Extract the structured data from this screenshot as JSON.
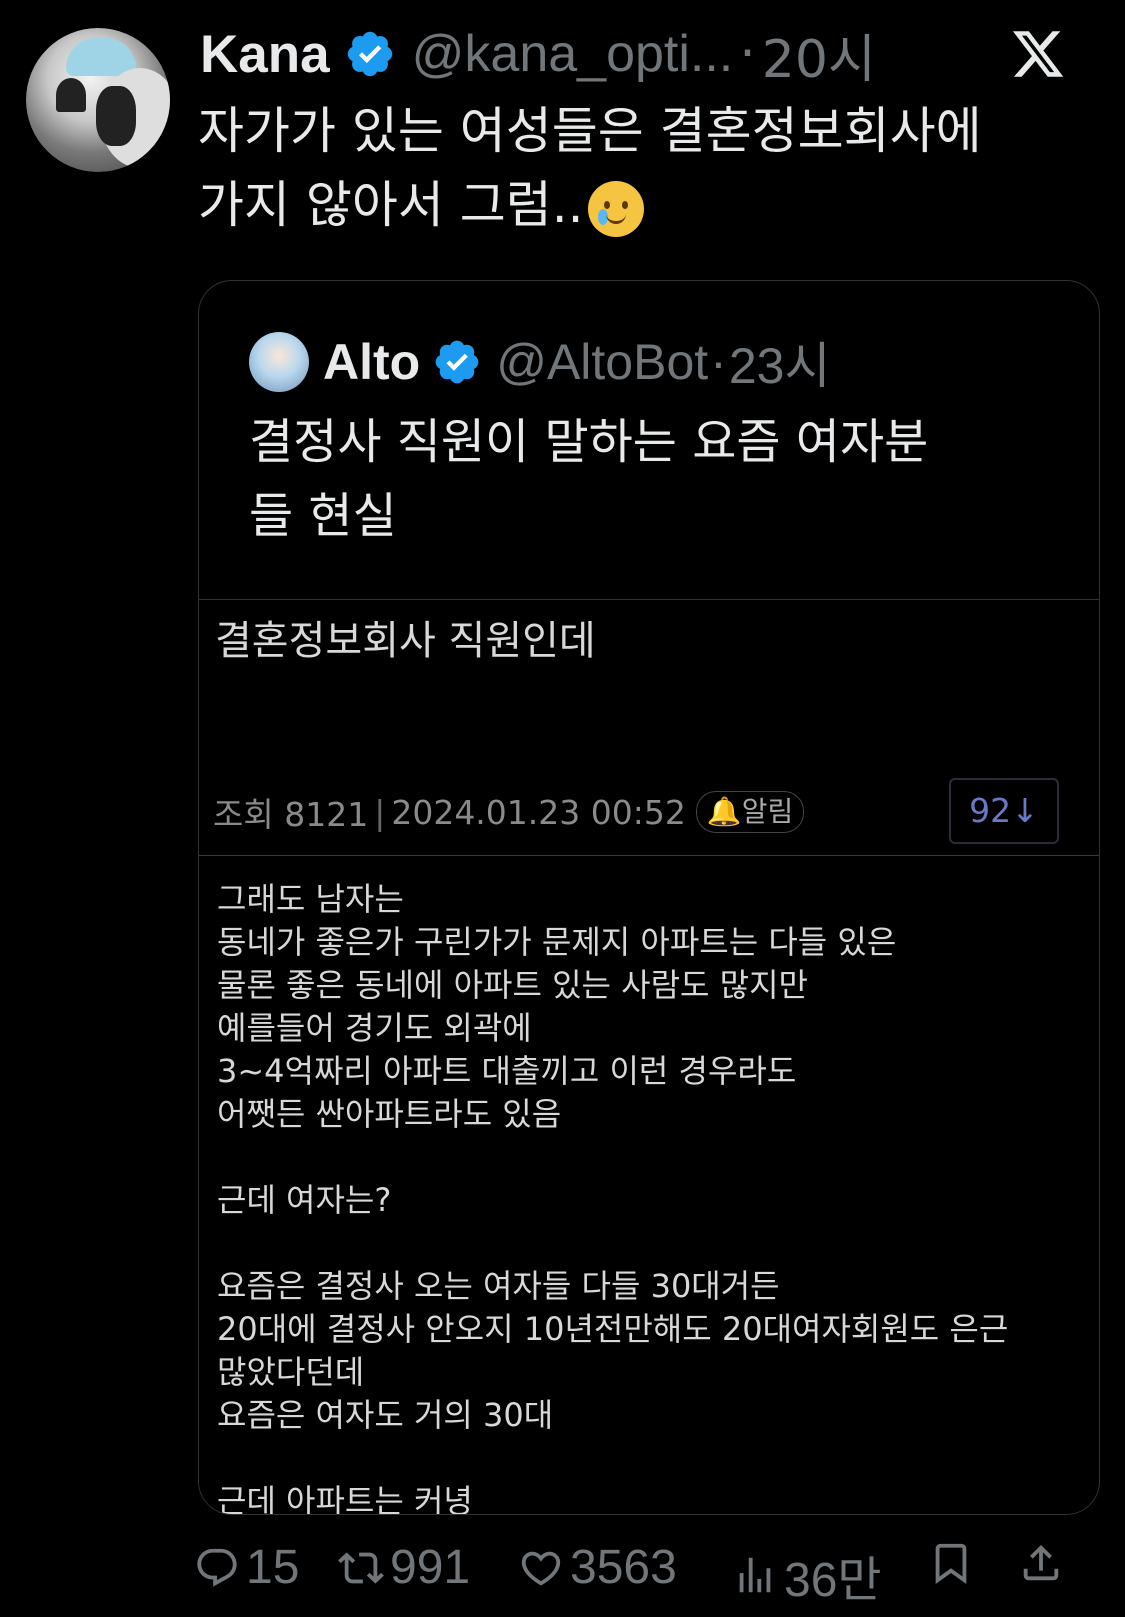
{
  "tweet": {
    "author_name": "Kana",
    "handle": "@kana_opti...",
    "separator": "·",
    "time": "20시",
    "text_line1": "자가가 있는 여성들은 결혼정보회사에",
    "text_line2": "가지 않아서 그럼..",
    "emoji": "face-holding-back-tears"
  },
  "quoted": {
    "author_name": "Alto",
    "handle": "@AltoBot",
    "separator": "·",
    "time": "23시",
    "text_line1": "결정사 직원이 말하는 요즘 여자분",
    "text_line2": "들 현실"
  },
  "media": {
    "title": "결혼정보회사 직원인데",
    "views": "조회 8121",
    "date": "2024.01.23 00:52",
    "alarm": "알림",
    "count": "92",
    "body": [
      "그래도 남자는",
      "동네가 좋은가 구린가가 문제지 아파트는 다들 있은",
      "물론 좋은 동네에 아파트 있는 사람도 많지만",
      "예를들어 경기도 외곽에",
      "3~4억짜리 아파트 대출끼고 이런 경우라도",
      "어쨋든 싼아파트라도 있음",
      "",
      "근데 여자는?",
      "",
      "요즘은 결정사 오는 여자들 다들 30대거든",
      "20대에 결정사 안오지 10년전만해도 20대여자회원도 은근",
      "많았다던데",
      "요즘은 여자도 거의 30대",
      "",
      "근데 아파트는 커녕"
    ]
  },
  "actions": {
    "replies": "15",
    "retweets": "991",
    "likes": "3563",
    "views": "36만"
  },
  "colors": {
    "background": "#000000",
    "text": "#e7e9ea",
    "muted": "#71767b",
    "verified": "#1d9bf0"
  }
}
